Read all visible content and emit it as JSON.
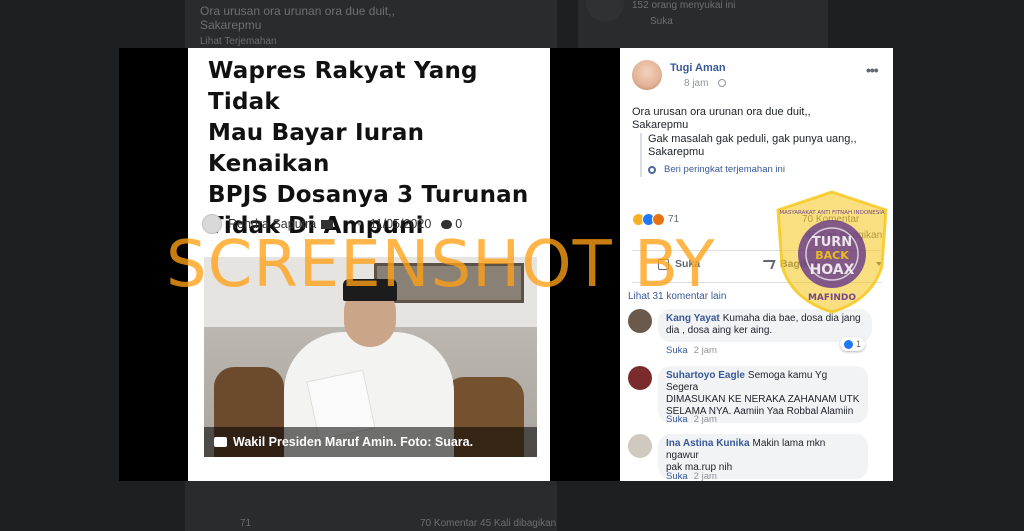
{
  "background": {
    "post_line1": "Ora urusan ora urunan ora due duit,,",
    "post_line2": "Sakarepmu",
    "see_translation": "Lihat Terjemahan",
    "comments_top": "152 orang menyukai ini",
    "like_top": "Suka",
    "footer_count": "71",
    "footer_stats": "70 Komentar  45 Kali dibagikan"
  },
  "article": {
    "headline_lines": [
      "Wapres Rakyat Yang Tidak",
      "Mau Bayar Iuran Kenaikan",
      "BPJS Dosanya 3 Turunan",
      "Tidak Di Ampuni"
    ],
    "author": "Rendra Saputra",
    "date": "11/05/2020",
    "comment_count": "0",
    "photo_caption": "Wakil Presiden Maruf Amin. Foto: Suara."
  },
  "watermark": "SCREENSHOT BY",
  "badge": {
    "top_text": "MASYARAKAT ANTI FITNAH INDONESIA",
    "center_line1": "TURN",
    "center_line2": "BACK",
    "center_line3": "HOAX",
    "bottom_text": "MAFINDO",
    "color_gold": "#f5c518",
    "color_purple": "#5b2d8a"
  },
  "post": {
    "author": "Tugi Aman",
    "time": "8 jam",
    "more": "•••",
    "text_line1": "Ora urusan ora urunan ora due duit,,",
    "text_line2": "Sakarepmu",
    "translation_line1": "Gak masalah gak peduli, gak punya uang,,",
    "translation_line2": "Sakarepmu",
    "rate_translation": "Beri peringkat terjemahan ini",
    "reaction_count": "71",
    "comment_stats": "70 Komentar",
    "share_stats": "45 Kali dibagikan",
    "like_label": "Suka",
    "share_label": "Bagikan",
    "see_more_comments": "Lihat 31 komentar lain"
  },
  "comments": [
    {
      "name": "Kang Yayat",
      "text_line1": "Kumaha dia bae, dosa dia jang",
      "text_line2": "dia , dosa aing ker aing.",
      "like": "Suka",
      "time": "2 jam",
      "reactions": "1"
    },
    {
      "name": "Suhartoyo Eagle",
      "text_line1": "Semoga kamu Yg Segera",
      "text_line2": "DIMASUKAN KE NERAKA ZAHANAM UTK",
      "text_line3": "SELAMA NYA. Aamiin Yaa Robbal Alamiin",
      "like": "Suka",
      "time": "2 jam"
    },
    {
      "name": "Ina Astina Kunika",
      "text_line1": "Makin lama mkn ngawur",
      "text_line2": "pak ma.rup nih",
      "like": "Suka",
      "time": "2 jam"
    }
  ],
  "colors": {
    "link_blue": "#385898",
    "watermark_orange": "#ffa014",
    "like_blue": "#2078f4"
  }
}
